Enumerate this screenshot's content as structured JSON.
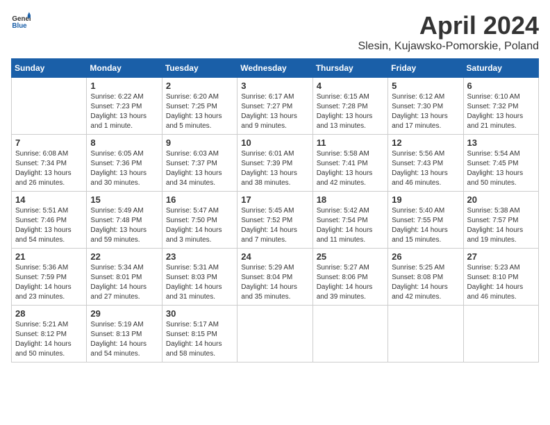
{
  "header": {
    "logo_general": "General",
    "logo_blue": "Blue",
    "month_title": "April 2024",
    "subtitle": "Slesin, Kujawsko-Pomorskie, Poland"
  },
  "calendar": {
    "days_of_week": [
      "Sunday",
      "Monday",
      "Tuesday",
      "Wednesday",
      "Thursday",
      "Friday",
      "Saturday"
    ],
    "weeks": [
      [
        {
          "day": "",
          "info": ""
        },
        {
          "day": "1",
          "info": "Sunrise: 6:22 AM\nSunset: 7:23 PM\nDaylight: 13 hours\nand 1 minute."
        },
        {
          "day": "2",
          "info": "Sunrise: 6:20 AM\nSunset: 7:25 PM\nDaylight: 13 hours\nand 5 minutes."
        },
        {
          "day": "3",
          "info": "Sunrise: 6:17 AM\nSunset: 7:27 PM\nDaylight: 13 hours\nand 9 minutes."
        },
        {
          "day": "4",
          "info": "Sunrise: 6:15 AM\nSunset: 7:28 PM\nDaylight: 13 hours\nand 13 minutes."
        },
        {
          "day": "5",
          "info": "Sunrise: 6:12 AM\nSunset: 7:30 PM\nDaylight: 13 hours\nand 17 minutes."
        },
        {
          "day": "6",
          "info": "Sunrise: 6:10 AM\nSunset: 7:32 PM\nDaylight: 13 hours\nand 21 minutes."
        }
      ],
      [
        {
          "day": "7",
          "info": "Sunrise: 6:08 AM\nSunset: 7:34 PM\nDaylight: 13 hours\nand 26 minutes."
        },
        {
          "day": "8",
          "info": "Sunrise: 6:05 AM\nSunset: 7:36 PM\nDaylight: 13 hours\nand 30 minutes."
        },
        {
          "day": "9",
          "info": "Sunrise: 6:03 AM\nSunset: 7:37 PM\nDaylight: 13 hours\nand 34 minutes."
        },
        {
          "day": "10",
          "info": "Sunrise: 6:01 AM\nSunset: 7:39 PM\nDaylight: 13 hours\nand 38 minutes."
        },
        {
          "day": "11",
          "info": "Sunrise: 5:58 AM\nSunset: 7:41 PM\nDaylight: 13 hours\nand 42 minutes."
        },
        {
          "day": "12",
          "info": "Sunrise: 5:56 AM\nSunset: 7:43 PM\nDaylight: 13 hours\nand 46 minutes."
        },
        {
          "day": "13",
          "info": "Sunrise: 5:54 AM\nSunset: 7:45 PM\nDaylight: 13 hours\nand 50 minutes."
        }
      ],
      [
        {
          "day": "14",
          "info": "Sunrise: 5:51 AM\nSunset: 7:46 PM\nDaylight: 13 hours\nand 54 minutes."
        },
        {
          "day": "15",
          "info": "Sunrise: 5:49 AM\nSunset: 7:48 PM\nDaylight: 13 hours\nand 59 minutes."
        },
        {
          "day": "16",
          "info": "Sunrise: 5:47 AM\nSunset: 7:50 PM\nDaylight: 14 hours\nand 3 minutes."
        },
        {
          "day": "17",
          "info": "Sunrise: 5:45 AM\nSunset: 7:52 PM\nDaylight: 14 hours\nand 7 minutes."
        },
        {
          "day": "18",
          "info": "Sunrise: 5:42 AM\nSunset: 7:54 PM\nDaylight: 14 hours\nand 11 minutes."
        },
        {
          "day": "19",
          "info": "Sunrise: 5:40 AM\nSunset: 7:55 PM\nDaylight: 14 hours\nand 15 minutes."
        },
        {
          "day": "20",
          "info": "Sunrise: 5:38 AM\nSunset: 7:57 PM\nDaylight: 14 hours\nand 19 minutes."
        }
      ],
      [
        {
          "day": "21",
          "info": "Sunrise: 5:36 AM\nSunset: 7:59 PM\nDaylight: 14 hours\nand 23 minutes."
        },
        {
          "day": "22",
          "info": "Sunrise: 5:34 AM\nSunset: 8:01 PM\nDaylight: 14 hours\nand 27 minutes."
        },
        {
          "day": "23",
          "info": "Sunrise: 5:31 AM\nSunset: 8:03 PM\nDaylight: 14 hours\nand 31 minutes."
        },
        {
          "day": "24",
          "info": "Sunrise: 5:29 AM\nSunset: 8:04 PM\nDaylight: 14 hours\nand 35 minutes."
        },
        {
          "day": "25",
          "info": "Sunrise: 5:27 AM\nSunset: 8:06 PM\nDaylight: 14 hours\nand 39 minutes."
        },
        {
          "day": "26",
          "info": "Sunrise: 5:25 AM\nSunset: 8:08 PM\nDaylight: 14 hours\nand 42 minutes."
        },
        {
          "day": "27",
          "info": "Sunrise: 5:23 AM\nSunset: 8:10 PM\nDaylight: 14 hours\nand 46 minutes."
        }
      ],
      [
        {
          "day": "28",
          "info": "Sunrise: 5:21 AM\nSunset: 8:12 PM\nDaylight: 14 hours\nand 50 minutes."
        },
        {
          "day": "29",
          "info": "Sunrise: 5:19 AM\nSunset: 8:13 PM\nDaylight: 14 hours\nand 54 minutes."
        },
        {
          "day": "30",
          "info": "Sunrise: 5:17 AM\nSunset: 8:15 PM\nDaylight: 14 hours\nand 58 minutes."
        },
        {
          "day": "",
          "info": ""
        },
        {
          "day": "",
          "info": ""
        },
        {
          "day": "",
          "info": ""
        },
        {
          "day": "",
          "info": ""
        }
      ]
    ]
  }
}
